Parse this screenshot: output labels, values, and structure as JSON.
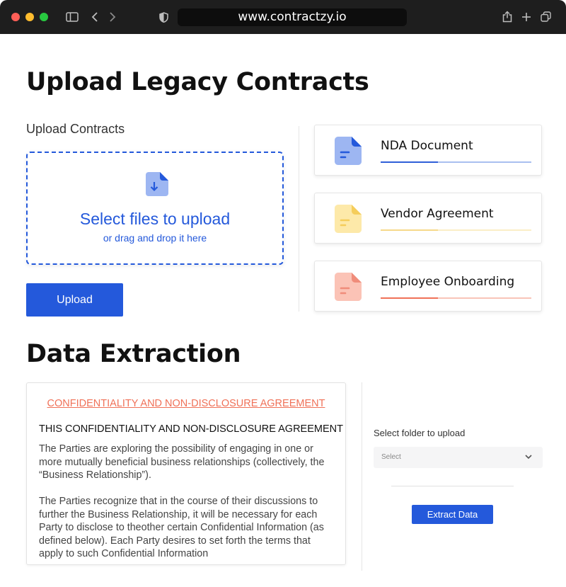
{
  "browser": {
    "url": "www.contractzy.io"
  },
  "upload_section": {
    "title": "Upload Legacy Contracts",
    "label": "Upload Contracts",
    "dropzone": {
      "title": "Select files to upload",
      "subtitle": "or drag and drop it here"
    },
    "upload_button": "Upload",
    "documents": [
      {
        "name": "NDA Document",
        "progress": 0.38,
        "color": "#2f5fd8",
        "track_color": "#a9bff0",
        "icon_color": "#9db6f2",
        "accent": "#2459db"
      },
      {
        "name": "Vendor Agreement",
        "progress": 0.38,
        "color": "#f6d98a",
        "track_color": "#fbeec7",
        "icon_color": "#fde9a9",
        "accent": "#f5cd5b"
      },
      {
        "name": "Employee Onboarding",
        "progress": 0.38,
        "color": "#f07158",
        "track_color": "#f8c4b8",
        "icon_color": "#fbc3b6",
        "accent": "#f08c7a"
      }
    ]
  },
  "extraction_section": {
    "title": "Data Extraction",
    "contract": {
      "title": "CONFIDENTIALITY AND NON-DISCLOSURE AGREEMENT",
      "heading": "THIS CONFIDENTIALITY AND NON-DISCLOSURE AGREEMENT",
      "paragraph_1": "The Parties are exploring the possibility of engaging in one or more mutually beneficial business relationships (collectively, the “Business Relationship”).",
      "paragraph_2": "The Parties recognize that in the course of their discussions to further the Business Relationship, it will be necessary for each Party to disclose to theother certain Confidential Information (as defined below). Each Party desires to set forth the terms that apply to such Confidential Information"
    },
    "folder_label": "Select folder to upload",
    "select_value": "Select",
    "extract_button": "Extract Data"
  },
  "colors": {
    "primary": "#2459db",
    "accent_red": "#f07158"
  }
}
